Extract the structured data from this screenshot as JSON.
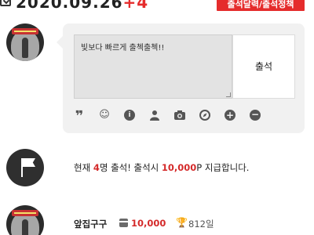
{
  "header": {
    "date": "2020.09.26",
    "date_suffix": "+4",
    "calendar_button": "출석달력/출석정책"
  },
  "comment": {
    "text": "빛보다 빠르게 출첵출첵!!",
    "submit_label": "출석",
    "toolbar_icons": [
      "quote-icon",
      "emoji-icon",
      "info-icon",
      "user-icon",
      "camera-icon",
      "compass-icon",
      "plus-icon",
      "minus-icon"
    ]
  },
  "notice": {
    "prefix": "현재 ",
    "count": "4",
    "middle": "명 출석! 출석시 ",
    "points": "10,000",
    "suffix": "P 지급합니다."
  },
  "entry": {
    "name": "앞집구구",
    "points": "10,000",
    "days": "812일"
  },
  "colors": {
    "accent": "#e52c2c",
    "box_bg": "#f1f1f1"
  }
}
